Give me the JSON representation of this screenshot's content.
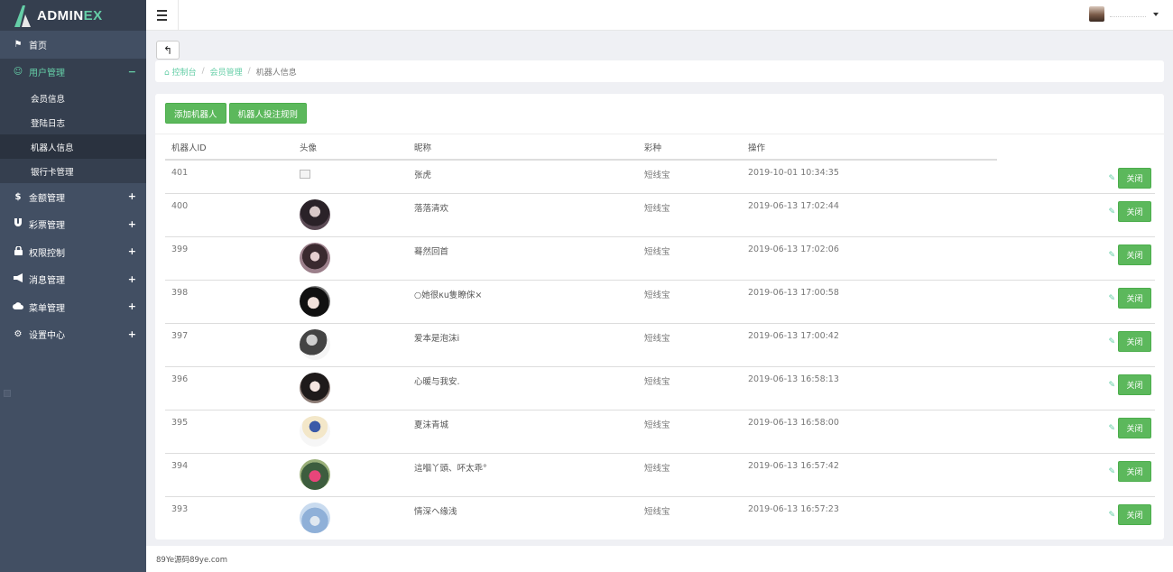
{
  "brand": {
    "name_part1": "ADMIN",
    "name_part2": "EX",
    "accent": "#65cea7",
    "sidebar_bg": "#424f63"
  },
  "sidebar": {
    "items": [
      {
        "label": "首页",
        "icon": "flag-icon"
      },
      {
        "label": "用户管理",
        "icon": "smile-icon",
        "expander": "−",
        "active": true,
        "children": [
          {
            "label": "会员信息"
          },
          {
            "label": "登陆日志"
          },
          {
            "label": "机器人信息",
            "current": true
          },
          {
            "label": "银行卡管理"
          }
        ]
      },
      {
        "label": "金额管理",
        "icon": "dollar-icon",
        "expander": "+"
      },
      {
        "label": "彩票管理",
        "icon": "magnet-icon",
        "expander": "+"
      },
      {
        "label": "权限控制",
        "icon": "lock-icon",
        "expander": "+"
      },
      {
        "label": "消息管理",
        "icon": "bullhorn-icon",
        "expander": "+"
      },
      {
        "label": "菜单管理",
        "icon": "cloud-icon",
        "expander": "+"
      },
      {
        "label": "设置中心",
        "icon": "gear-icon",
        "expander": "+"
      }
    ]
  },
  "header": {
    "menu_icon": "hamburger-icon"
  },
  "breadcrumb": {
    "home": "控制台",
    "section": "会员管理",
    "current": "机器人信息"
  },
  "toolbar": {
    "add_label": "添加机器人",
    "rules_label": "机器人投注规则"
  },
  "table": {
    "columns": [
      "机器人ID",
      "头像",
      "昵称",
      "彩种",
      "操作",
      ""
    ],
    "close_label": "关闭",
    "rows": [
      {
        "id": "401",
        "nickname": "张虎",
        "lottery": "短线宝",
        "time": "2019-10-01 10:34:35",
        "avatar": "broken-image"
      },
      {
        "id": "400",
        "nickname": "落落清欢",
        "lottery": "短线宝",
        "time": "2019-06-13 17:02:44",
        "avatar": "photo"
      },
      {
        "id": "399",
        "nickname": "蓦然回首",
        "lottery": "短线宝",
        "time": "2019-06-13 17:02:06",
        "avatar": "photo"
      },
      {
        "id": "398",
        "nickname": "○她很κu隻瞭俕×",
        "lottery": "短线宝",
        "time": "2019-06-13 17:00:58",
        "avatar": "photo"
      },
      {
        "id": "397",
        "nickname": "爱本是泡沫i",
        "lottery": "短线宝",
        "time": "2019-06-13 17:00:42",
        "avatar": "photo"
      },
      {
        "id": "396",
        "nickname": "心暖与我安.",
        "lottery": "短线宝",
        "time": "2019-06-13 16:58:13",
        "avatar": "photo"
      },
      {
        "id": "395",
        "nickname": "夏沫青城",
        "lottery": "短线宝",
        "time": "2019-06-13 16:58:00",
        "avatar": "photo"
      },
      {
        "id": "394",
        "nickname": "這嗰丫頭、吥太乖°",
        "lottery": "短线宝",
        "time": "2019-06-13 16:57:42",
        "avatar": "photo"
      },
      {
        "id": "393",
        "nickname": "情深ヘ缘浅",
        "lottery": "短线宝",
        "time": "2019-06-13 16:57:23",
        "avatar": "photo"
      }
    ]
  },
  "footer": {
    "text": "89Ye源码89ye.com"
  }
}
